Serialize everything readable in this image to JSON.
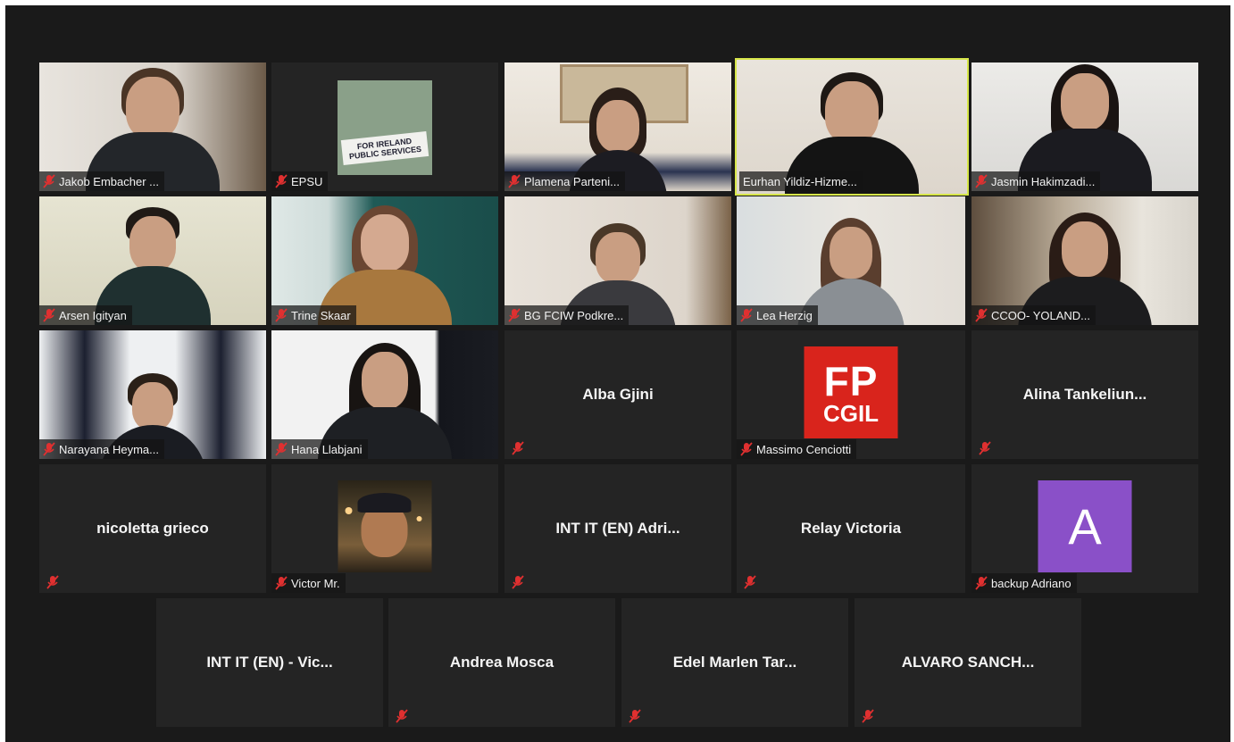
{
  "colors": {
    "background": "#1a1a1a",
    "tile": "#242424",
    "active_speaker_border": "#d7e64a",
    "muted_mic": "#e03030",
    "avatar_purple": "#8a50c8",
    "fp_cgil_red": "#d9241c"
  },
  "icons": {
    "muted": "muted-mic-icon"
  },
  "participants": [
    {
      "name": "Jakob Embacher ...",
      "mode": "video"
    },
    {
      "name": "EPSU",
      "mode": "image",
      "image_text": "FOR IRELAND PUBLIC SERVICES"
    },
    {
      "name": "Plamena Parteni...",
      "mode": "video"
    },
    {
      "name": "Eurhan Yildiz-Hizme...",
      "mode": "video",
      "active": true
    },
    {
      "name": "Jasmin Hakimzadi...",
      "mode": "video"
    },
    {
      "name": "Arsen Igityan",
      "mode": "video"
    },
    {
      "name": "Trine Skaar",
      "mode": "video"
    },
    {
      "name": "BG FCIW Podkre...",
      "mode": "video"
    },
    {
      "name": "Lea Herzig",
      "mode": "video"
    },
    {
      "name": "CCOO- YOLAND...",
      "mode": "video"
    },
    {
      "name": "Narayana Heyma...",
      "mode": "video"
    },
    {
      "name": "Hana Llabjani",
      "mode": "video"
    },
    {
      "name": "Alba Gjini",
      "mode": "name"
    },
    {
      "name": "Massimo Cenciotti",
      "mode": "logo",
      "logo_top": "FP",
      "logo_bottom": "CGIL"
    },
    {
      "name": "Alina Tankeliun...",
      "mode": "name"
    },
    {
      "name": "nicoletta grieco",
      "mode": "name"
    },
    {
      "name": "Victor Mr.",
      "mode": "image"
    },
    {
      "name": "INT IT (EN) Adri...",
      "mode": "name"
    },
    {
      "name": "Relay Victoria",
      "mode": "name"
    },
    {
      "name": "backup Adriano",
      "mode": "avatar",
      "avatar_letter": "A"
    },
    {
      "name": "INT IT (EN) - Vic...",
      "mode": "name"
    },
    {
      "name": "Andrea Mosca",
      "mode": "name"
    },
    {
      "name": "Edel Marlen Tar...",
      "mode": "name"
    },
    {
      "name": "ALVARO SANCH...",
      "mode": "name"
    }
  ]
}
